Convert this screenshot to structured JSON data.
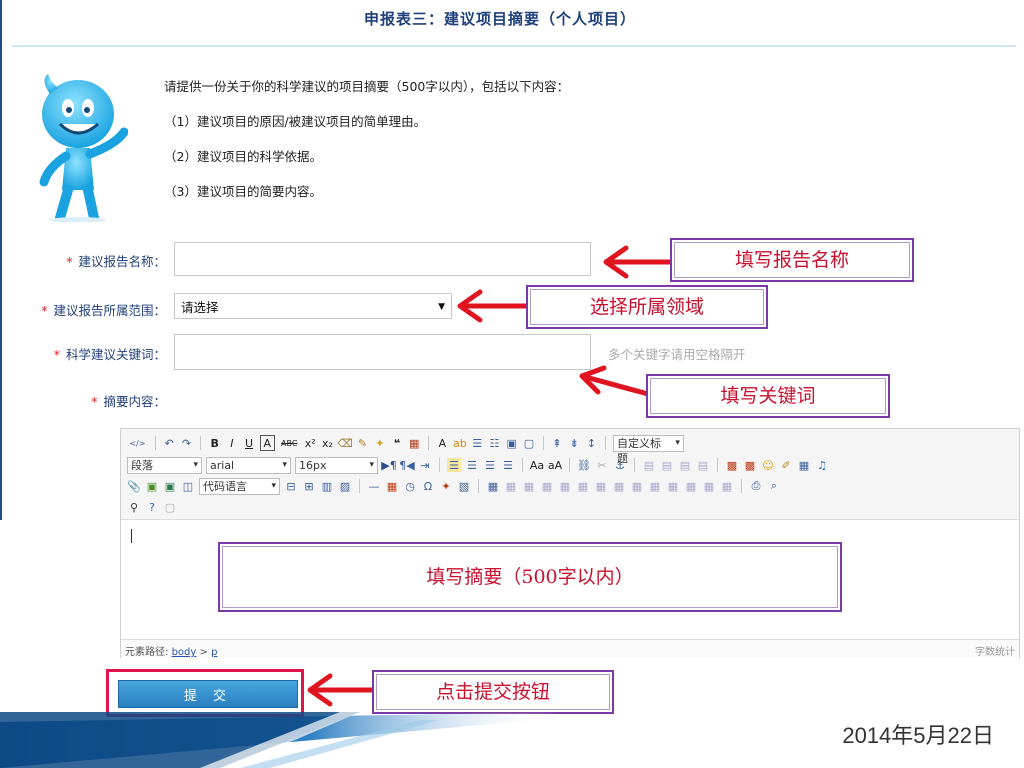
{
  "title": "申报表三：建议项目摘要（个人项目）",
  "intro": {
    "line1": "请提供一份关于你的科学建议的项目摘要（500字以内），包括以下内容：",
    "line2": "（1）建议项目的原因/被建议项目的简单理由。",
    "line3": "（2）建议项目的科学依据。",
    "line4": "（3）建议项目的简要内容。"
  },
  "form": {
    "required_mark": "*",
    "report_name_label": "建议报告名称：",
    "report_name_value": "",
    "scope_label": "建议报告所属范围：",
    "scope_selected": "请选择",
    "keywords_label": "科学建议关键词：",
    "keywords_value": "",
    "keywords_hint": "多个关键字请用空格隔开",
    "summary_label": "摘要内容："
  },
  "editor": {
    "paragraph_select": "段落",
    "font_select": "arial",
    "size_select": "16px",
    "custom_title_select": "自定义标题",
    "code_lang_select": "代码语言",
    "status_path_label": "元素路径:",
    "status_path_body": "body",
    "status_path_sep": ">",
    "status_path_p": "p",
    "word_count_label": "字数统计"
  },
  "callouts": {
    "report_name": "填写报告名称",
    "scope": "选择所属领域",
    "keywords": "填写关键词",
    "summary": "填写摘要（500字以内）",
    "submit": "点击提交按钮"
  },
  "submit_label": "提 交",
  "footer_date": "2014年5月22日",
  "colors": {
    "title": "#1e3f7a",
    "label": "#1f3f7a",
    "required": "#e02020",
    "callout_text": "#c8102e",
    "callout_border": "#7a3aa6",
    "arrow": "#e0141e",
    "submit_bg": "#2a7fc0",
    "submit_highlight": "#e0144c",
    "band_dark": "#0e4a86"
  }
}
